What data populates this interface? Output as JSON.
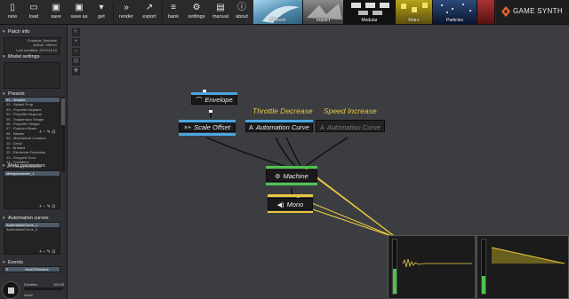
{
  "toolbar": {
    "buttons": [
      {
        "label": "new",
        "icon": "new-file-icon"
      },
      {
        "label": "load",
        "icon": "folder-icon"
      },
      {
        "label": "save",
        "icon": "save-icon"
      },
      {
        "label": "save as",
        "icon": "save-as-icon"
      },
      {
        "label": "get",
        "icon": "download-icon"
      },
      {
        "label": "render",
        "icon": "render-icon"
      },
      {
        "label": "export",
        "icon": "export-icon"
      },
      {
        "label": "bank",
        "icon": "bank-icon"
      },
      {
        "label": "settings",
        "icon": "gear-icon"
      },
      {
        "label": "manual",
        "icon": "book-icon"
      },
      {
        "label": "about",
        "icon": "info-icon"
      }
    ],
    "thumbnails": [
      {
        "label": "Whoosh"
      },
      {
        "label": "Impact"
      },
      {
        "label": "Modular"
      },
      {
        "label": "Retro"
      },
      {
        "label": "Particles"
      }
    ],
    "logo_text": "GAME SYNTH"
  },
  "left_panel": {
    "patch_info": {
      "title": "Patch info",
      "name": "Example_Machine",
      "author": "Author: 4Kliner",
      "modified": "Last modified: 2017/11/15"
    },
    "model_settings": {
      "title": "Model settings"
    },
    "presets": {
      "title": "Presets",
      "items": [
        "01 - Wooble",
        "02 - Splash Drop",
        "03 - Propeller Airplane",
        "04 - Propeller Airgrone",
        "05 - Suspension Stinger",
        "06 - Propeller Stinger",
        "07 - Popcorn Beam",
        "08 - Blaster",
        "09 - Mechanical Creature",
        "10 - Droid",
        "11 - Bristled",
        "12 - Electronic Fireworks",
        "13 - Dropped Door",
        "14 - Footsteps",
        "15 - Creepy Ambience"
      ],
      "selected_index": 0
    },
    "meta_parameters": {
      "title": "Meta parameters",
      "items": [
        "Metaparameter_1"
      ],
      "selected_index": 0
    },
    "automation_curves": {
      "title": "Automation curves",
      "items": [
        "AutomationCurve_1",
        "AutomationCurve_2"
      ],
      "selected_index": 0
    },
    "events": {
      "title": "Events",
      "columns": [
        "0",
        "EndOfTimeline"
      ]
    },
    "bottom": {
      "duration_label": "Duration",
      "duration_value": "100.00",
      "level_label": "Level"
    }
  },
  "canvas": {
    "tools": [
      "select-icon",
      "zoom-in-icon",
      "zoom-out-icon",
      "fit-icon",
      "pan-icon"
    ],
    "labels": {
      "throttle": "Throttle Decrease",
      "speed": "Speed Increase"
    },
    "nodes": {
      "envelope": {
        "title": "Envelope",
        "icon": "envelope-icon",
        "icon_glyph": "⌒"
      },
      "scale_offset": {
        "title": "Scale Offset",
        "icon": "scale-offset-icon",
        "icon_glyph": "×+"
      },
      "automation_1": {
        "title": "Automation Curve",
        "icon": "automation-icon",
        "icon_glyph": "A"
      },
      "automation_2": {
        "title": "Automation Curve",
        "icon": "automation-icon",
        "icon_glyph": "A"
      },
      "machine": {
        "title": "Machine",
        "icon": "machine-icon",
        "icon_glyph": "⚙"
      },
      "mono": {
        "title": "Mono",
        "icon": "speaker-icon",
        "icon_glyph": "◀)"
      }
    }
  },
  "colors": {
    "accent_blue": "#4aa6e0",
    "accent_green": "#4ec24e",
    "accent_yellow": "#e8c840",
    "wire": "#111111",
    "panel": "#2f3033",
    "canvas": "#3c3d40"
  }
}
